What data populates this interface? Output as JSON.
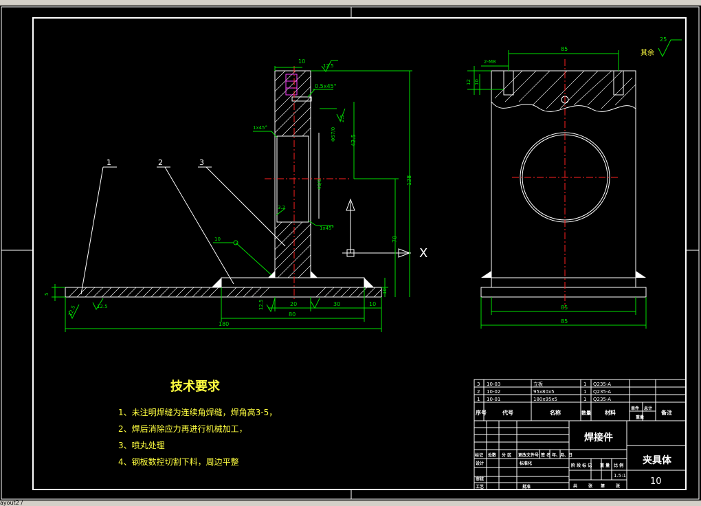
{
  "window": {
    "status_fragment": "ayout2 /"
  },
  "drawing": {
    "part_labels": [
      "1",
      "2",
      "3"
    ],
    "front_view_dims": {
      "top_width": "10",
      "surface_finish_top": "12.5",
      "chamfer_top": "0.5x45°",
      "chamfer_upper": "1x45°",
      "chamfer_lower": "1x45°",
      "bore_label": "Φ57/0",
      "hole_label": "40/0",
      "dim_42_5": "42.5",
      "dim_128": "128",
      "dim_70": "70",
      "dim_10_right": "10",
      "dim_5_left": "5",
      "weld_symbol": "10",
      "dim_3_2": "3.2",
      "dim_2_5": "2.5",
      "dim_12_5_a": "12.5",
      "dim_12_5_b": "12.5",
      "dim_12_5_c": "12.5",
      "dim_20": "20",
      "dim_30": "30",
      "dim_10_base": "10",
      "dim_80": "80",
      "dim_180": "180",
      "section_mark": "X"
    },
    "side_view_dims": {
      "top_85": "85",
      "thread": "2-M8",
      "dim_12": "12",
      "dim_10": "10",
      "bottom_85_inner": "85",
      "bottom_85_outer": "85",
      "rest_label": "其余",
      "rest_value": "25"
    }
  },
  "tech_requirements": {
    "title": "技术要求",
    "items": [
      "1、未注明焊缝为连续角焊缝，焊角高3-5，",
      "2、焊后消除应力再进行机械加工，",
      "3、喷丸处理",
      "4、钢板数控切割下料，周边平整"
    ]
  },
  "bom": {
    "rows": [
      {
        "no": "3",
        "code": "10-03",
        "name": "立板",
        "qty": "1",
        "material": "Q235-A"
      },
      {
        "no": "2",
        "code": "10-02",
        "name": "95x80x5",
        "qty": "1",
        "material": "Q235-A"
      },
      {
        "no": "1",
        "code": "10-01",
        "name": "180x95x5",
        "qty": "1",
        "material": "Q235-A"
      }
    ],
    "header": {
      "no": "序号",
      "code": "代号",
      "name": "名称",
      "qty": "数量",
      "material": "材料",
      "unit": "单件",
      "total": "总计",
      "weight": "重量",
      "remark": "备注"
    }
  },
  "title_block": {
    "part_type": "焊接件",
    "drawing_name": "夹具体",
    "drawing_number": "10",
    "scale": "1.5:1",
    "row_labels_top": [
      "标记",
      "处数",
      "分 区",
      "更改文件号",
      "签 名",
      "年、月、日"
    ],
    "designer": "设计",
    "standardization": "标准化",
    "review": "审核",
    "process": "工艺",
    "approve": "批准",
    "stage_labels": [
      "阶 段 标 记",
      "重 量",
      "比 例"
    ],
    "sheet_labels": [
      "共",
      "张",
      "第",
      "张"
    ]
  }
}
